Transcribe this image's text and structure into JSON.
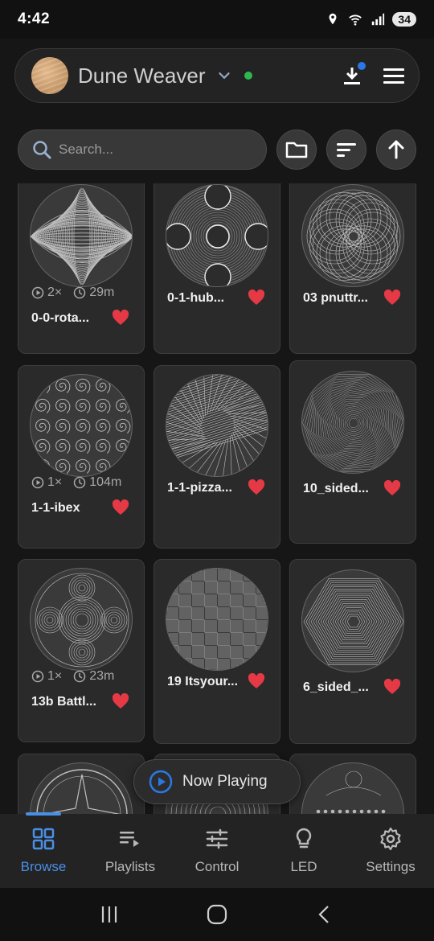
{
  "status": {
    "time": "4:42",
    "battery": "34"
  },
  "header": {
    "title": "Dune Weaver"
  },
  "search": {
    "placeholder": "Search..."
  },
  "patterns": [
    {
      "name": "0-0-rota...",
      "plays": "2×",
      "duration": "29m",
      "favorite": true,
      "style": "rotated"
    },
    {
      "name": "0-1-hub...",
      "favorite": true,
      "style": "hub"
    },
    {
      "name": "03 pnuttr...",
      "favorite": true,
      "style": "flower"
    },
    {
      "name": "1-1-ibex",
      "plays": "1×",
      "duration": "104m",
      "favorite": true,
      "style": "spirals"
    },
    {
      "name": "1-1-pizza...",
      "favorite": true,
      "style": "pizza"
    },
    {
      "name": "10_sided...",
      "favorite": true,
      "style": "tunnel"
    },
    {
      "name": "13b Battl...",
      "plays": "1×",
      "duration": "23m",
      "favorite": true,
      "style": "battle"
    },
    {
      "name": "19 Itsyour...",
      "favorite": true,
      "style": "checker"
    },
    {
      "name": "6_sided_...",
      "favorite": true,
      "style": "hex"
    },
    {
      "name": "",
      "favorite": false,
      "style": "compass"
    },
    {
      "name": "",
      "favorite": false,
      "style": "plain"
    },
    {
      "name": "",
      "favorite": false,
      "style": "moon"
    }
  ],
  "now_playing": {
    "label": "Now Playing"
  },
  "nav": {
    "items": [
      {
        "label": "Browse",
        "icon": "grid-icon",
        "active": true
      },
      {
        "label": "Playlists",
        "icon": "playlist-icon",
        "active": false
      },
      {
        "label": "Control",
        "icon": "sliders-icon",
        "active": false
      },
      {
        "label": "LED",
        "icon": "bulb-icon",
        "active": false
      },
      {
        "label": "Settings",
        "icon": "gear-icon",
        "active": false
      }
    ]
  },
  "colors": {
    "accent": "#4a8fe6",
    "heart": "#e53945",
    "online": "#2eb84f",
    "badge": "#2a78e4"
  }
}
